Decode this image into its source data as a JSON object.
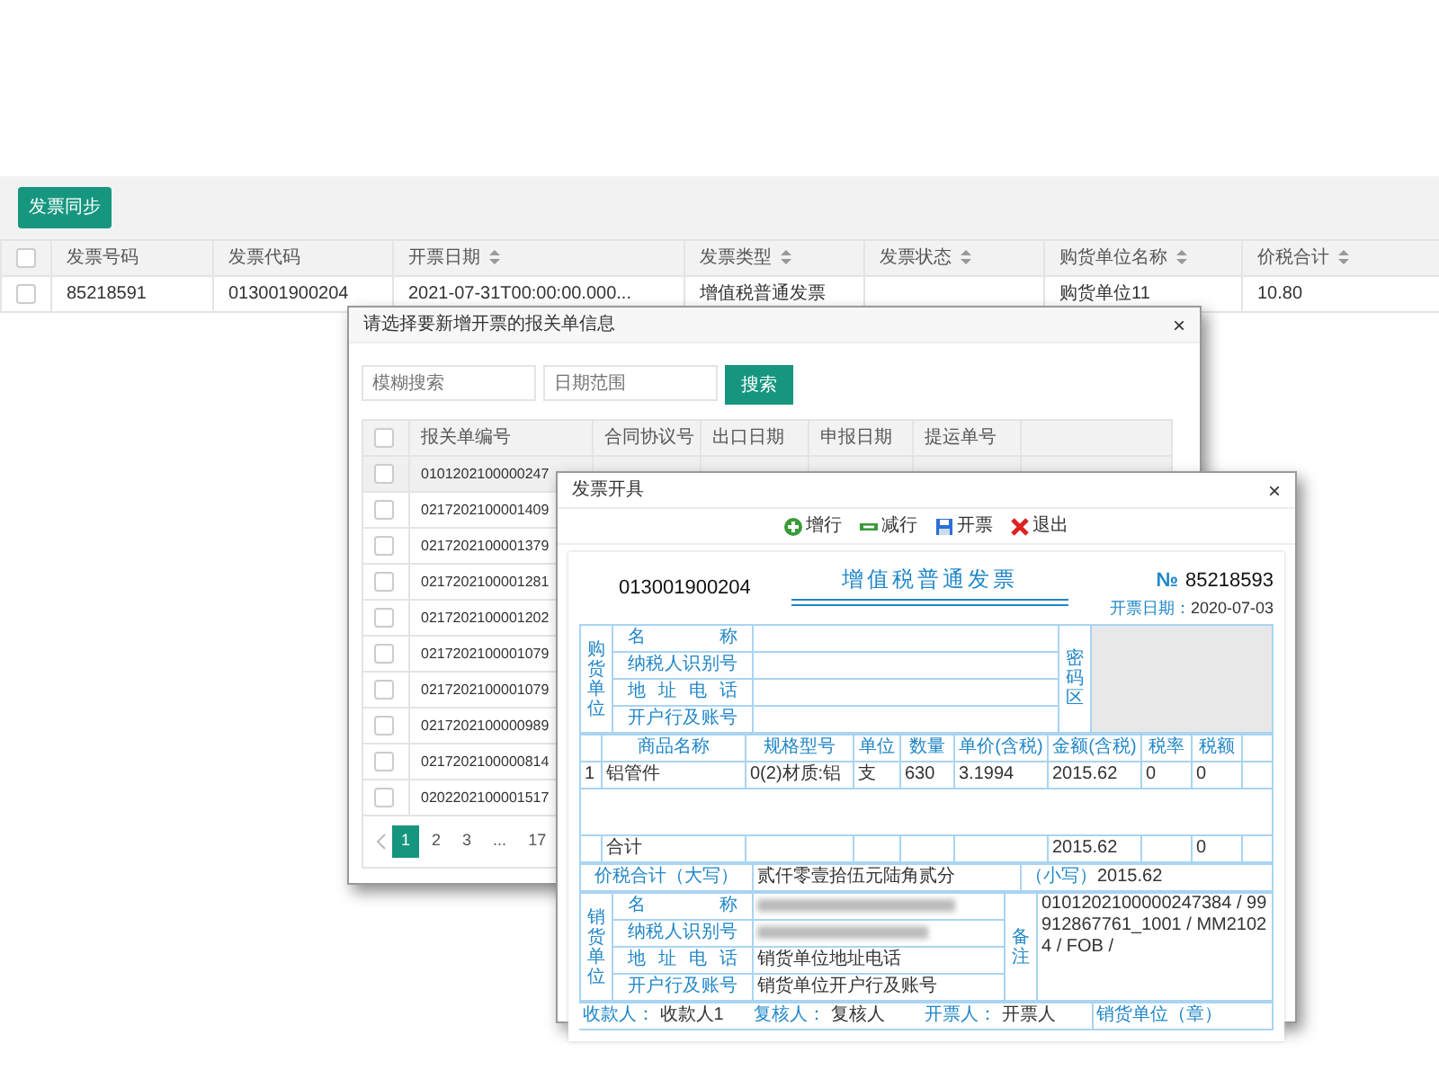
{
  "sync_button": "发票同步",
  "invoice_list": {
    "header_checked": false,
    "columns": [
      {
        "label": "发票号码",
        "sortable": false
      },
      {
        "label": "发票代码",
        "sortable": false
      },
      {
        "label": "开票日期",
        "sortable": true
      },
      {
        "label": "发票类型",
        "sortable": true
      },
      {
        "label": "发票状态",
        "sortable": true
      },
      {
        "label": "购货单位名称",
        "sortable": true
      },
      {
        "label": "价税合计",
        "sortable": true
      }
    ],
    "rows": [
      {
        "checked": false,
        "cells": [
          "85218591",
          "013001900204",
          "2021-07-31T00:00:00.000...",
          "增值税普通发票",
          null,
          "购货单位11",
          "10.80"
        ]
      }
    ]
  },
  "declaration_dialog": {
    "title": "请选择要新增开票的报关单信息",
    "close": "×",
    "search_placeholder": "模糊搜索",
    "date_placeholder": "日期范围",
    "search_button": "搜索",
    "header_checked": false,
    "columns": [
      "报关单编号",
      "合同协议号",
      "出口日期",
      "申报日期",
      "提运单号"
    ],
    "rows": [
      {
        "number": "0101202100000247",
        "selected": true,
        "checked": false
      },
      {
        "number": "0217202100001409",
        "selected": false,
        "checked": false
      },
      {
        "number": "0217202100001379",
        "selected": false,
        "checked": false
      },
      {
        "number": "0217202100001281",
        "selected": false,
        "checked": false
      },
      {
        "number": "0217202100001202",
        "selected": false,
        "checked": false
      },
      {
        "number": "0217202100001079",
        "selected": false,
        "checked": false
      },
      {
        "number": "0217202100001079",
        "selected": false,
        "checked": false
      },
      {
        "number": "0217202100000989",
        "selected": false,
        "checked": false
      },
      {
        "number": "0217202100000814",
        "selected": false,
        "checked": false
      },
      {
        "number": "0202202100001517",
        "selected": false,
        "checked": false
      }
    ],
    "pages": [
      {
        "label": "1",
        "selected": true
      },
      {
        "label": "2",
        "selected": false
      },
      {
        "label": "3",
        "selected": false
      },
      {
        "label": "...",
        "selected": false
      },
      {
        "label": "17",
        "selected": false
      }
    ]
  },
  "invoice_dialog": {
    "title": "发票开具",
    "close": "×",
    "toolbar": [
      {
        "kind": "add",
        "label": "增行"
      },
      {
        "kind": "remove",
        "label": "减行"
      },
      {
        "kind": "save",
        "label": "开票"
      },
      {
        "kind": "exit",
        "label": "退出"
      }
    ],
    "invoice": {
      "code": "013001900204",
      "title": "增值税普通发票",
      "number_mark": "№",
      "number": "85218593",
      "date_label": "开票日期：",
      "date": "2020-07-03",
      "buyer_label": "购货单位",
      "buyer_fields": [
        "名称",
        "纳税人识别号",
        "地址电话",
        "开户行及账号"
      ],
      "password_label": "密码区",
      "goods_columns": [
        "商品名称",
        "规格型号",
        "单位",
        "数量",
        "单价(含税)",
        "金额(含税)",
        "税率",
        "税额"
      ],
      "goods_rows": [
        [
          "1",
          "铝管件",
          "0(2)材质:铝",
          "支",
          "630",
          "3.1994",
          "2015.62",
          "0",
          "0"
        ]
      ],
      "total_label": "合计",
      "total_amount": "2015.62",
      "total_tax": "0",
      "sum_label": "价税合计（大写）",
      "sum_words": "贰仟零壹拾伍元陆角贰分",
      "sum_small_label": "（小写）",
      "sum_small": "2015.62",
      "seller_label": "销货单位",
      "seller_fields": [
        {
          "label": "名称",
          "blurred": true
        },
        {
          "label": "纳税人识别号",
          "blurred": true
        },
        {
          "label": "地址电话",
          "value": "销货单位地址电话"
        },
        {
          "label": "开户行及账号",
          "value": "销货单位开户行及账号"
        }
      ],
      "remark_label": "备注",
      "remark": "0101202100000247384 / 99912867761_1001 / MM21024 / FOB /",
      "signers": [
        {
          "label": "收款人：",
          "value": "收款人1"
        },
        {
          "label": "复核人：",
          "value": "复核人"
        },
        {
          "label": "开票人：",
          "value": "开票人"
        }
      ],
      "seal_label": "销货单位（章）"
    }
  }
}
